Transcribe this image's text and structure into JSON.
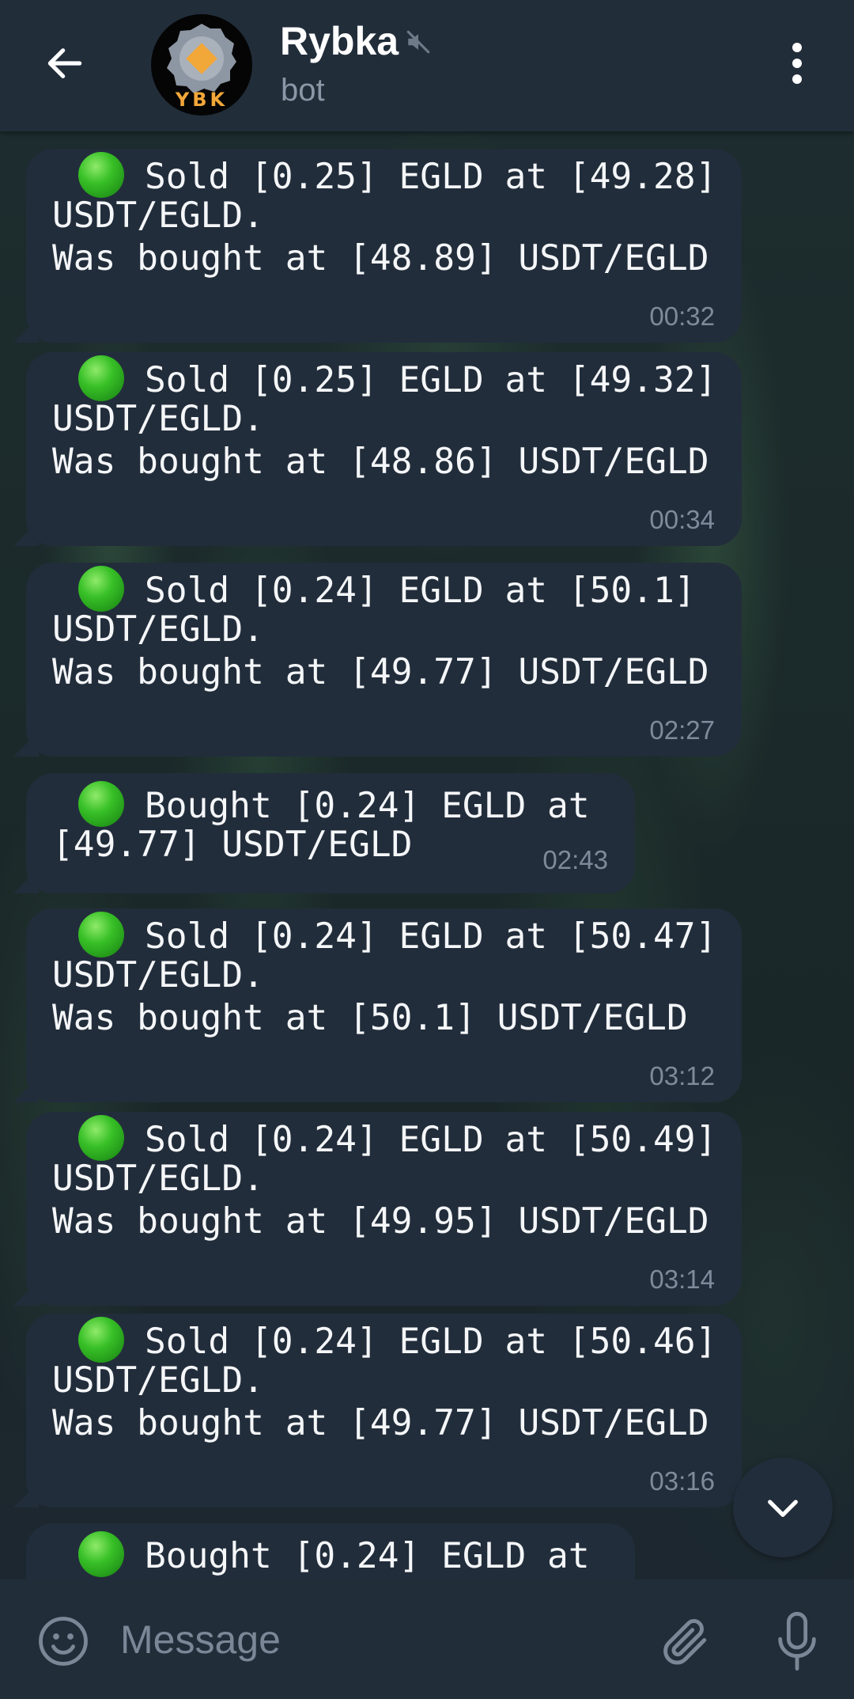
{
  "header": {
    "title": "Rybka",
    "subtitle": "bot",
    "avatar_text": "YBK"
  },
  "messages": [
    {
      "lines": [
        "Sold [0.25] EGLD at [49.28]",
        "USDT/EGLD.",
        "Was bought at [48.89] USDT/EGLD"
      ],
      "time": "00:32"
    },
    {
      "lines": [
        "Sold [0.25] EGLD at [49.32]",
        "USDT/EGLD.",
        "Was bought at [48.86] USDT/EGLD"
      ],
      "time": "00:34"
    },
    {
      "lines": [
        "Sold [0.24] EGLD at [50.1]",
        "USDT/EGLD.",
        "Was bought at [49.77] USDT/EGLD"
      ],
      "time": "02:27"
    },
    {
      "lines": [
        "Bought [0.24] EGLD at",
        "[49.77] USDT/EGLD"
      ],
      "time": "02:43"
    },
    {
      "lines": [
        "Sold [0.24] EGLD at [50.47]",
        "USDT/EGLD.",
        "Was bought at [50.1] USDT/EGLD"
      ],
      "time": "03:12"
    },
    {
      "lines": [
        "Sold [0.24] EGLD at [50.49]",
        "USDT/EGLD.",
        "Was bought at [49.95] USDT/EGLD"
      ],
      "time": "03:14"
    },
    {
      "lines": [
        "Sold [0.24] EGLD at [50.46]",
        "USDT/EGLD.",
        "Was bought at [49.77] USDT/EGLD"
      ],
      "time": "03:16"
    },
    {
      "lines": [
        "Bought [0.24] EGLD at"
      ]
    }
  ],
  "composer": {
    "placeholder": "Message"
  },
  "colors": {
    "header_bg": "#222d3a",
    "bubble_bg": "#222d3b",
    "status_dot": "#2fb527",
    "avatar_accent": "#f2a739"
  },
  "icons": {
    "back": "arrow-left-icon",
    "mute": "muted-speaker-icon",
    "menu": "more-vertical-icon",
    "scroll": "chevron-down-icon",
    "emoji": "smiley-icon",
    "attach": "paperclip-icon",
    "mic": "microphone-icon"
  }
}
